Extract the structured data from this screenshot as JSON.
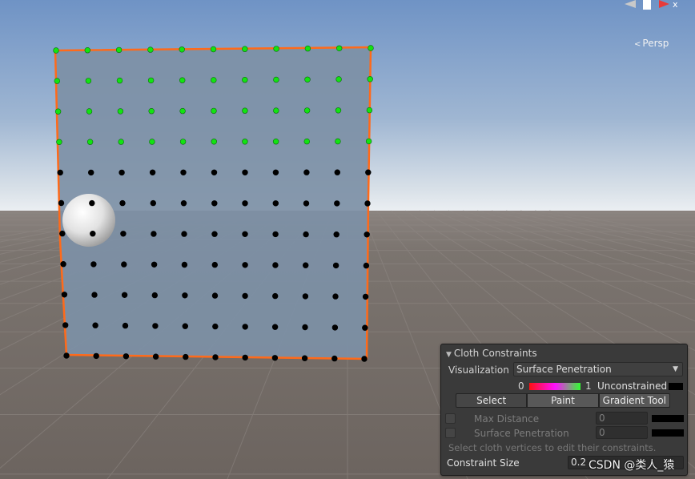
{
  "viewport": {
    "projection_label": "Persp",
    "sky_top": "#6f93c5",
    "horizon": "#e8edf2",
    "ground": "#736b66",
    "cloth_fill": "#7e92a8",
    "cloth_border": "#ff6a1a",
    "constrained_vertex_color": "#12e312",
    "unconstrained_vertex_color": "#000000",
    "sphere_color": "#e6e6e6"
  },
  "cloth_constraints": {
    "title": "Cloth Constraints",
    "visualization": {
      "label": "Visualization",
      "value": "Surface Penetration"
    },
    "legend": {
      "min": "0",
      "max": "1",
      "unconstrained_label": "Unconstrained"
    },
    "tools": [
      {
        "label": "Select",
        "active": true
      },
      {
        "label": "Paint",
        "active": false
      },
      {
        "label": "Gradient Tool",
        "active": false
      }
    ],
    "properties": [
      {
        "label": "Max Distance",
        "value": "0"
      },
      {
        "label": "Surface Penetration",
        "value": "0"
      }
    ],
    "help_text": "Select cloth vertices to edit their constraints.",
    "constraint_size": {
      "label": "Constraint Size",
      "value": "0.2"
    }
  },
  "watermark": "CSDN @类人_猿"
}
